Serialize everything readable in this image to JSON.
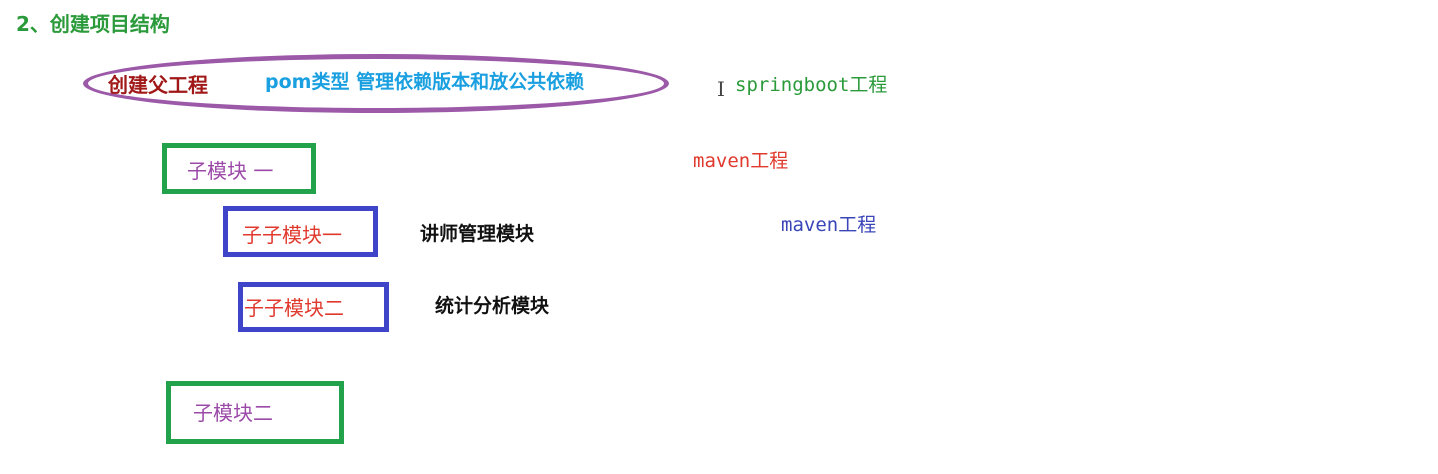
{
  "heading": "2、创建项目结构",
  "parent": {
    "label": "创建父工程",
    "description": "pom类型  管理依赖版本和放公共依赖"
  },
  "annotations": {
    "text_cursor": "I",
    "springboot": "springboot工程",
    "maven_red": "maven工程",
    "maven_blue": "maven工程"
  },
  "modules": {
    "sub_one": "子模块 一",
    "subsub_one": "子子模块一",
    "subsub_one_desc": "讲师管理模块",
    "subsub_two": "子子模块二",
    "subsub_two_desc": "统计分析模块",
    "sub_two": "子模块二"
  },
  "colors": {
    "heading": "#2a9a3a",
    "ellipse": "#9b59a8",
    "parent_label": "#a01818",
    "pom_label": "#1aa0e0",
    "green_box": "#22a24a",
    "blue_box": "#3f45c8",
    "module_purple": "#9b4aa8",
    "module_red": "#e03a2e"
  }
}
